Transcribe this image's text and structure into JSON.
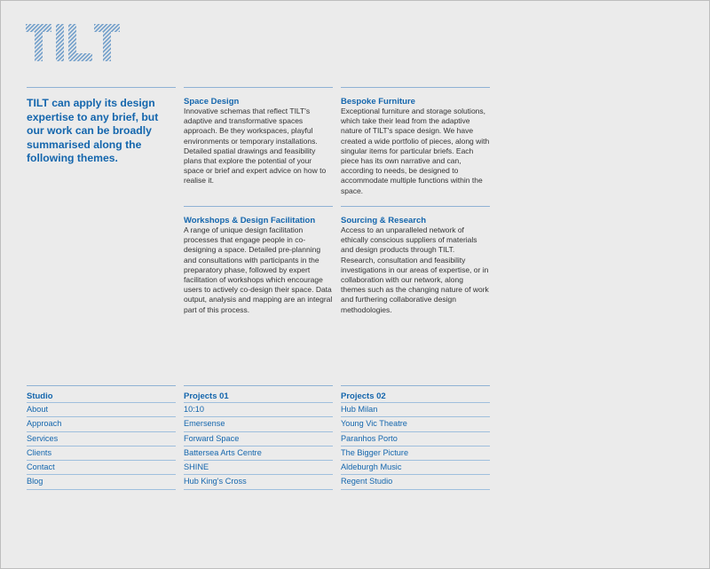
{
  "brand": {
    "logo_text": "TILT",
    "accent": "#1466ad"
  },
  "intro": "TILT can apply its design expertise to any brief, but our work can be broadly summarised along the following themes.",
  "services": [
    {
      "title": "Space Design",
      "body": "Innovative schemas that reflect TILT's adaptive and transformative spaces approach. Be they workspaces, playful environments or temporary installations. Detailed spatial drawings and feasibility plans that explore the potential of your space or brief and expert advice on how to realise it."
    },
    {
      "title": "Bespoke Furniture",
      "body": "Exceptional furniture and storage solutions, which take their lead from the adaptive nature of TILT's space design. We have created a wide portfolio of pieces, along with singular items for particular briefs. Each piece has its own narrative and can, according to needs, be designed to accommodate multiple functions within the space."
    },
    {
      "title": "Workshops & Design Facilitation",
      "body": "A range of unique design facilitation processes that engage people in co-designing a space. Detailed pre-planning and consultations with participants in the preparatory phase, followed by expert facilitation of workshops which encourage users to actively co-design their space. Data output, analysis and mapping are an integral part of this process."
    },
    {
      "title": "Sourcing & Research",
      "body": "Access to an unparalleled network of ethically conscious suppliers of materials and design products through TILT. Research, consultation and feasibility investigations in our areas of expertise, or in collaboration with our network, along themes such as the changing nature of work and furthering collaborative design methodologies."
    }
  ],
  "nav": {
    "studio": {
      "heading": "Studio",
      "items": [
        "About",
        "Approach",
        "Services",
        "Clients",
        "Contact",
        "Blog"
      ]
    },
    "projects01": {
      "heading": "Projects 01",
      "items": [
        "10:10",
        "Emersense",
        "Forward Space",
        "Battersea Arts Centre",
        "SHINE",
        "Hub King's Cross"
      ]
    },
    "projects02": {
      "heading": "Projects 02",
      "items": [
        "Hub Milan",
        "Young Vic Theatre",
        "Paranhos Porto",
        "The Bigger Picture",
        "Aldeburgh Music",
        "Regent Studio"
      ]
    }
  }
}
